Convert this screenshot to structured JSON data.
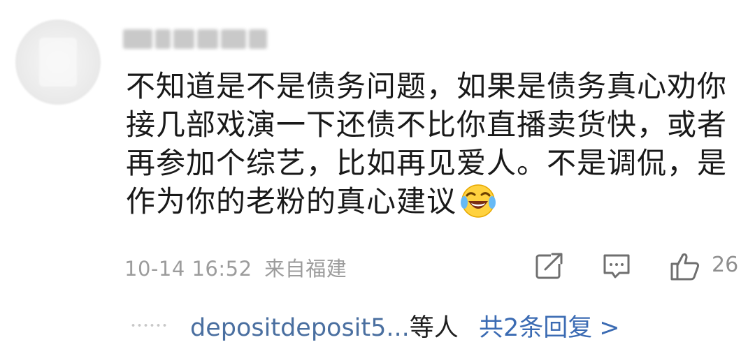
{
  "comment": {
    "username": "",
    "lines": [
      "不知道是不是债务问题，如果是债务真心劝你",
      "接几部戏演一下还债不比你直播卖货快，或者",
      "再参加个综艺，比如再见爱人。不是调侃，是",
      "作为你的老粉的真心建议"
    ],
    "emoji": "laughing-crying-emoji",
    "date": "10-14 16:52",
    "location": "来自福建",
    "like_count": "26"
  },
  "replies": {
    "user": "depositdeposit5...",
    "suffix": "等人",
    "link": "共2条回复",
    "chevron": ">"
  },
  "icons": {
    "share": "share-icon",
    "comment": "comment-icon",
    "like": "thumbs-up-icon"
  },
  "colors": {
    "link": "#3b6bb3",
    "meta": "#9c9c9c"
  }
}
